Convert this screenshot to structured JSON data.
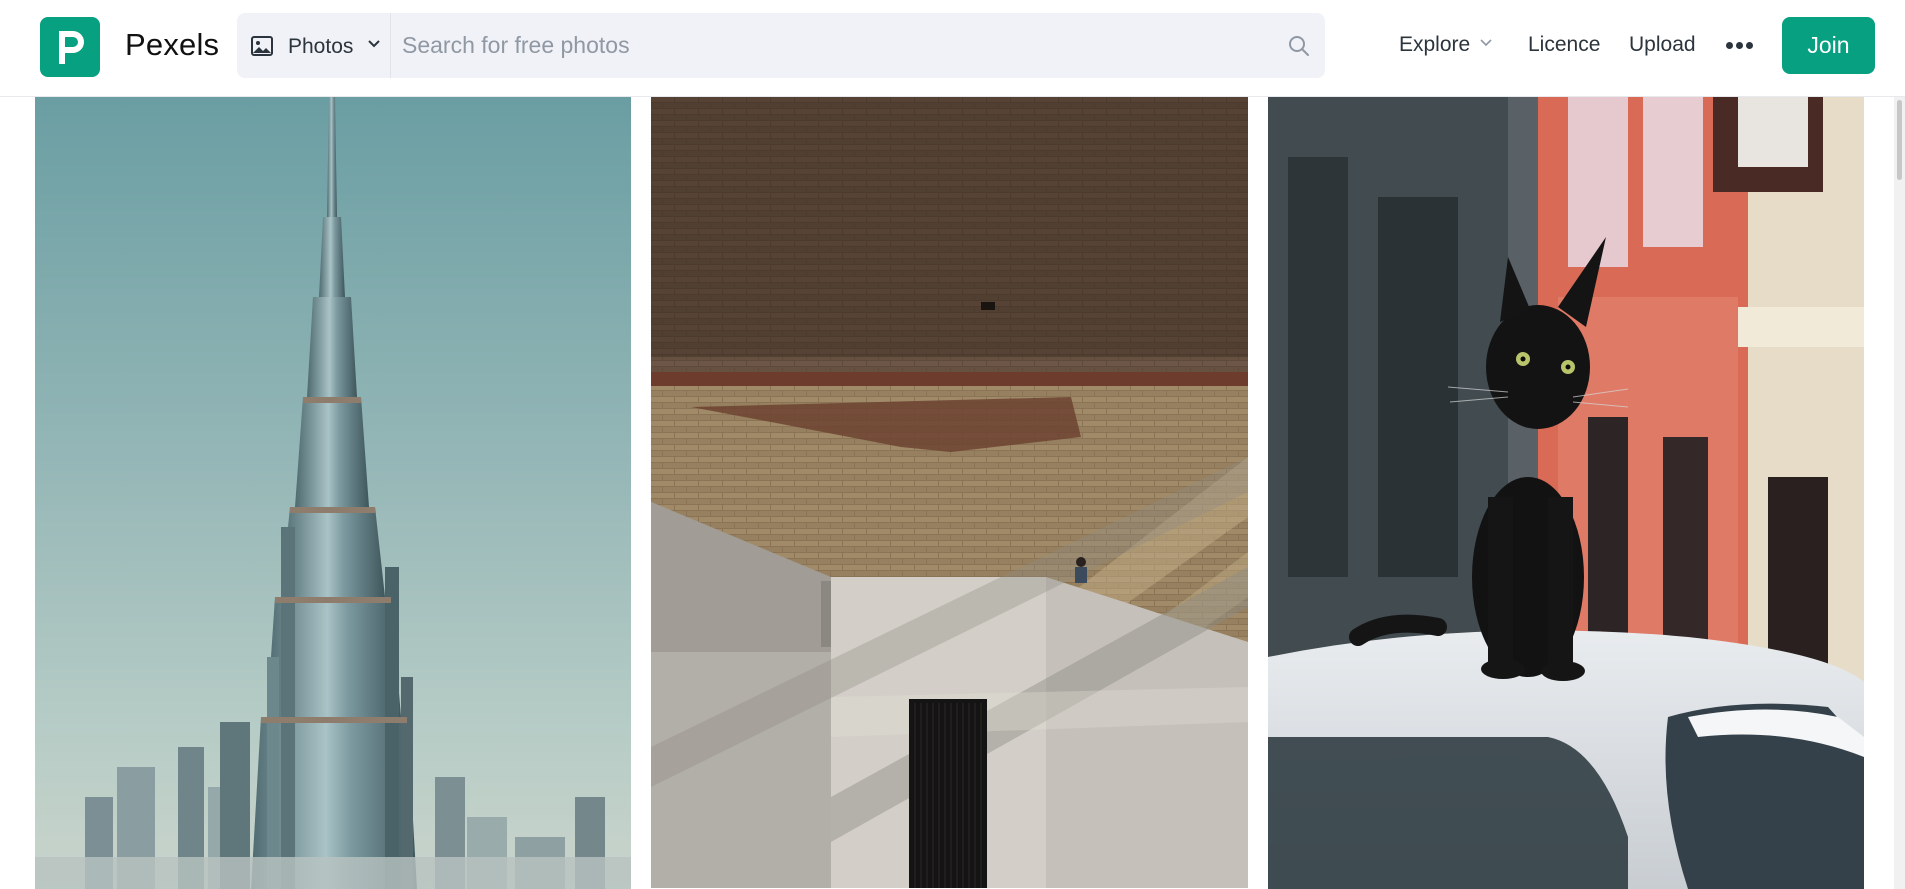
{
  "app": {
    "brand": "Pexels",
    "logo_letter": "P"
  },
  "search": {
    "type_label": "Photos",
    "placeholder": "Search for free photos",
    "value": ""
  },
  "nav": {
    "explore": "Explore",
    "licence": "Licence",
    "upload": "Upload",
    "join": "Join"
  },
  "photos": [
    {
      "subject": "Burj Khalifa skyscraper against clear sky"
    },
    {
      "subject": "Brick wall with shadowed staircase and person"
    },
    {
      "subject": "Black cat sitting on white car roof"
    }
  ],
  "colors": {
    "brand_green": "#07a081",
    "search_bg": "#f0f2f7",
    "text": "#2c343e",
    "placeholder": "#9098a3"
  },
  "icons": [
    "image-icon",
    "chevron-down-icon",
    "search-icon",
    "more-dots-icon"
  ]
}
